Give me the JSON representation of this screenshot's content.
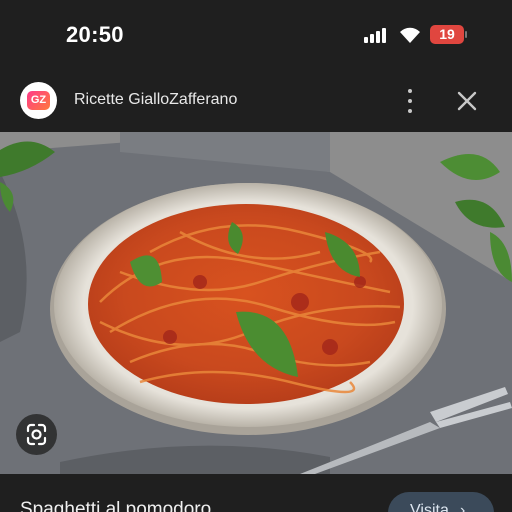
{
  "status_bar": {
    "time": "20:50",
    "battery_level": "19",
    "icons": [
      "signal-icon",
      "wifi-icon",
      "battery-icon"
    ]
  },
  "header": {
    "logo_text": "GZ",
    "site_name": "Ricette GialloZafferano",
    "icons": [
      "more-vert-icon",
      "close-icon"
    ]
  },
  "image": {
    "description_icon": "google-lens-icon"
  },
  "result": {
    "title": "Spaghetti al pomodoro",
    "visit_label": "Visita",
    "visit_icon": "chevron-right-icon"
  },
  "colors": {
    "background": "#1f1f1f",
    "battery": "#e0463f",
    "visit_button": "#3b4a5a"
  }
}
